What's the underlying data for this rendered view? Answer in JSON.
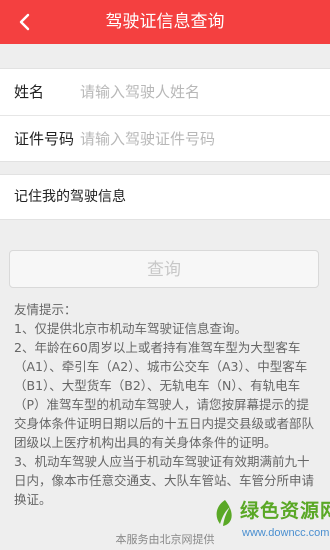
{
  "header": {
    "title": "驾驶证信息查询",
    "back_icon": "chevron-left-icon"
  },
  "form": {
    "name_label": "姓名",
    "name_placeholder": "请输入驾驶人姓名",
    "name_value": "",
    "id_label": "证件号码",
    "id_placeholder": "请输入驾驶证件号码",
    "id_value": ""
  },
  "remember": {
    "label": "记住我的驾驶信息"
  },
  "query_button": {
    "label": "查询"
  },
  "tips": {
    "heading": "友情提示：",
    "items": [
      "1、仅提供北京市机动车驾驶证信息查询。",
      "2、年龄在60周岁以上或者持有准驾车型为大型客车（A1）、牵引车（A2）、城市公交车（A3）、中型客车（B1）、大型货车（B2）、无轨电车（N）、有轨电车（P）准驾车型的机动车驾驶人，请您按屏幕提示的提交身体条件证明日期以后的十五日内提交县级或者部队团级以上医疗机构出具的有关身体条件的证明。",
      "3、机动车驾驶人应当于机动车驾驶证有效期满前九十日内，像本市任意交通支、大队车管站、车管分所申请换证。"
    ]
  },
  "footer": {
    "text": "本服务由北京网提供"
  },
  "watermark": {
    "text": "绿色资源网",
    "url": "www.downcc.com"
  },
  "colors": {
    "header_bg": "#f44040",
    "background": "#eeeeee",
    "watermark_green": "#5aa826"
  }
}
